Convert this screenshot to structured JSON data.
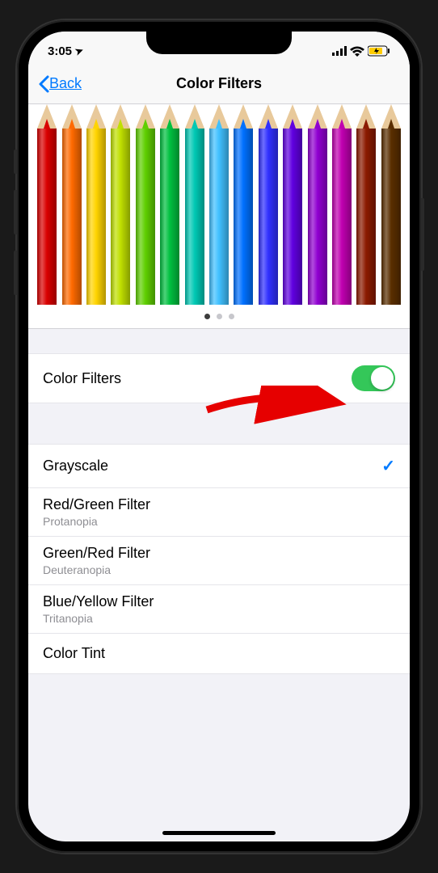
{
  "status": {
    "time": "3:05",
    "location_glyph": "➤",
    "signal_glyph": "••ıl",
    "wifi_glyph": "󾠀",
    "battery_glyph": "⚡"
  },
  "nav": {
    "back_label": "Back",
    "title": "Color Filters"
  },
  "pencil_colors": [
    "#d90000",
    "#ff6a00",
    "#ffd400",
    "#c0e000",
    "#5fcf00",
    "#00c040",
    "#00c8b4",
    "#40c0ff",
    "#0070ff",
    "#3030ff",
    "#6000e0",
    "#9000d0",
    "#c000b0",
    "#8b1a00",
    "#5a2e00"
  ],
  "pager": {
    "total": 3,
    "active": 0
  },
  "toggle_row": {
    "label": "Color Filters",
    "on": true
  },
  "filters": [
    {
      "label": "Grayscale",
      "subtitle": "",
      "selected": true
    },
    {
      "label": "Red/Green Filter",
      "subtitle": "Protanopia",
      "selected": false
    },
    {
      "label": "Green/Red Filter",
      "subtitle": "Deuteranopia",
      "selected": false
    },
    {
      "label": "Blue/Yellow Filter",
      "subtitle": "Tritanopia",
      "selected": false
    },
    {
      "label": "Color Tint",
      "subtitle": "",
      "selected": false
    }
  ],
  "arrow_color": "#e60000"
}
